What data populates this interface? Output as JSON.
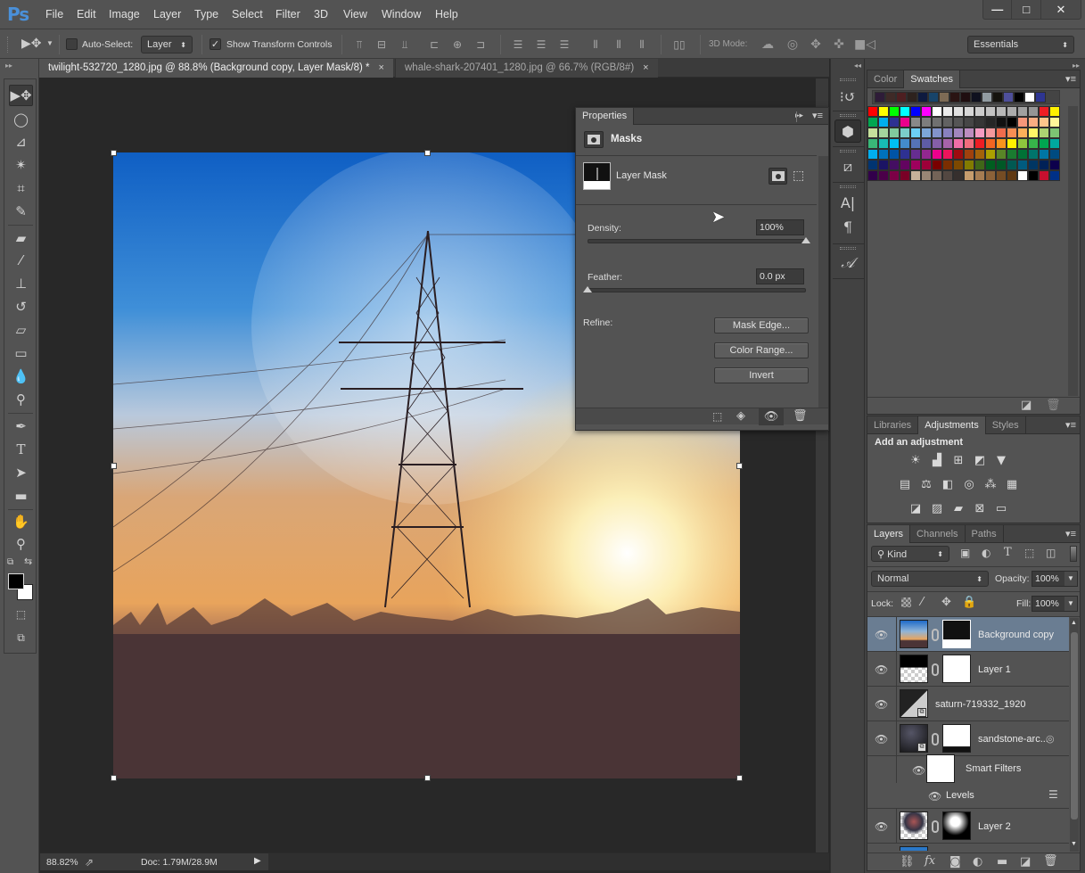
{
  "app": {
    "logo": "Ps",
    "menu": [
      "File",
      "Edit",
      "Image",
      "Layer",
      "Type",
      "Select",
      "Filter",
      "3D",
      "View",
      "Window",
      "Help"
    ],
    "window_controls": {
      "minimize": "—",
      "maximize": "□",
      "close": "✕"
    }
  },
  "options_bar": {
    "auto_select_label": "Auto-Select:",
    "auto_select_checked": false,
    "auto_select_target": "Layer",
    "show_transform_label": "Show Transform Controls",
    "show_transform_checked": true,
    "mode_3d_label": "3D Mode:",
    "workspace": "Essentials"
  },
  "tabs": [
    {
      "label": "twilight-532720_1280.jpg @ 88.8% (Background copy, Layer Mask/8) *",
      "active": true,
      "close": "×"
    },
    {
      "label": "whale-shark-207401_1280.jpg @ 66.7% (RGB/8#)",
      "active": false,
      "close": "×"
    }
  ],
  "status_bar": {
    "zoom": "88.82%",
    "doc_info": "Doc: 1.79M/28.9M"
  },
  "properties": {
    "tab_label": "Properties",
    "section": "Masks",
    "mask_label": "Layer Mask",
    "density_label": "Density:",
    "density_value": "100%",
    "density_fraction": 1.0,
    "feather_label": "Feather:",
    "feather_value": "0.0 px",
    "feather_fraction": 0.0,
    "refine_label": "Refine:",
    "buttons": {
      "mask_edge": "Mask Edge...",
      "color_range": "Color Range...",
      "invert": "Invert"
    }
  },
  "swatches_panel": {
    "tabs": [
      "Color",
      "Swatches"
    ],
    "active_tab": "Swatches",
    "recent": [
      "#2e1c38",
      "#3f2a27",
      "#4d1f21",
      "#2d221e",
      "#0e1a3f",
      "#17446a",
      "#7d6b55",
      "#2a1413",
      "#1f0e10",
      "#0f111f",
      "#919ba1",
      "#15130e",
      "#4e4f9a",
      "#000000",
      "#ffffff",
      "#2e3591"
    ],
    "grid": [
      [
        "#ff0000",
        "#ffff00",
        "#00ff00",
        "#00ffff",
        "#0000ff",
        "#ff00ff",
        "#ffffff",
        "#ebebeb",
        "#e1e1e1",
        "#d7d7d7",
        "#cccccc",
        "#c2c2c2",
        "#b7b7b7",
        "#acacac",
        "#a0a0a0",
        "#959595",
        "#ee1d24",
        "#fff100"
      ],
      [
        "#00a651",
        "#00aeef",
        "#2e3192",
        "#ec008c",
        "#898989",
        "#7d7d7d",
        "#707070",
        "#626262",
        "#555555",
        "#464646",
        "#363636",
        "#262626",
        "#111111",
        "#000000",
        "#f7977a",
        "#fbad82",
        "#fdc68c",
        "#fff799"
      ],
      [
        "#c6df9c",
        "#a4d49d",
        "#81ca9d",
        "#7bcdc9",
        "#6ccff7",
        "#7ca6d8",
        "#8293ca",
        "#8881be",
        "#a286bd",
        "#bc8cbf",
        "#f49bc1",
        "#f5999d",
        "#f16c4d",
        "#f68e54",
        "#fbaf5a",
        "#fff467",
        "#acd372",
        "#7dc473"
      ],
      [
        "#39b778",
        "#17bcb4",
        "#00bff3",
        "#438ccb",
        "#5573b7",
        "#5e5ca7",
        "#855fa8",
        "#a763a9",
        "#ef6ea8",
        "#f16d7e",
        "#ee1d24",
        "#f16522",
        "#f7941d",
        "#fff100",
        "#8fc63d",
        "#37b44a",
        "#00a650",
        "#00a99e"
      ],
      [
        "#00aeef",
        "#0072bc",
        "#0054a5",
        "#2e3192",
        "#662d91",
        "#92278f",
        "#ec008c",
        "#ed145b",
        "#9e0b0f",
        "#a0410d",
        "#a3620a",
        "#aba000",
        "#598527",
        "#1a7b30",
        "#007236",
        "#00746b",
        "#0076a4",
        "#004b80"
      ],
      [
        "#003471",
        "#1b1464",
        "#440e62",
        "#630460",
        "#9e005d",
        "#9e0039",
        "#790000",
        "#7b2e00",
        "#7d4900",
        "#827b00",
        "#406618",
        "#005e20",
        "#005826",
        "#005952",
        "#005b7f",
        "#003663",
        "#002157",
        "#0d004c"
      ],
      [
        "#32004b",
        "#4b0049",
        "#7b0046",
        "#7a0026",
        "#c7b299",
        "#998675",
        "#736357",
        "#534741",
        "#362f2d",
        "#c69c6d",
        "#a67c52",
        "#8c6239",
        "#754c24",
        "#603913",
        "#ffffff",
        "#000000",
        "#c8102e",
        "#003087"
      ]
    ]
  },
  "adjustments_panel": {
    "tabs": [
      "Libraries",
      "Adjustments",
      "Styles"
    ],
    "active_tab": "Adjustments",
    "heading": "Add an adjustment",
    "rows": [
      [
        "brightness-contrast-icon",
        "levels-icon",
        "curves-icon",
        "exposure-icon",
        "vibrance-icon"
      ],
      [
        "hue-saturation-icon",
        "color-balance-icon",
        "black-white-icon",
        "photo-filter-icon",
        "channel-mixer-icon",
        "color-lookup-icon"
      ],
      [
        "invert-icon",
        "posterize-icon",
        "threshold-icon",
        "selective-color-icon",
        "gradient-map-icon"
      ]
    ]
  },
  "layers_panel": {
    "tabs": [
      "Layers",
      "Channels",
      "Paths"
    ],
    "active_tab": "Layers",
    "filter_kind": "Kind",
    "blend_mode": "Normal",
    "opacity_label": "Opacity:",
    "opacity_value": "100%",
    "lock_label": "Lock:",
    "fill_label": "Fill:",
    "fill_value": "100%",
    "layers": [
      {
        "name": "Background copy",
        "selected": true,
        "has_mask": true
      },
      {
        "name": "Layer 1",
        "selected": false,
        "has_mask": true
      },
      {
        "name": "saturn-719332_1920",
        "selected": false,
        "has_mask": false,
        "smart_object": true
      },
      {
        "name": "sandstone-arc...",
        "selected": false,
        "has_mask": true,
        "smart_object": true
      },
      {
        "name": "Smart Filters",
        "sub": true
      },
      {
        "name": "Levels",
        "sub": true,
        "filter": true
      },
      {
        "name": "Layer 2",
        "selected": false,
        "has_mask": true
      }
    ]
  }
}
